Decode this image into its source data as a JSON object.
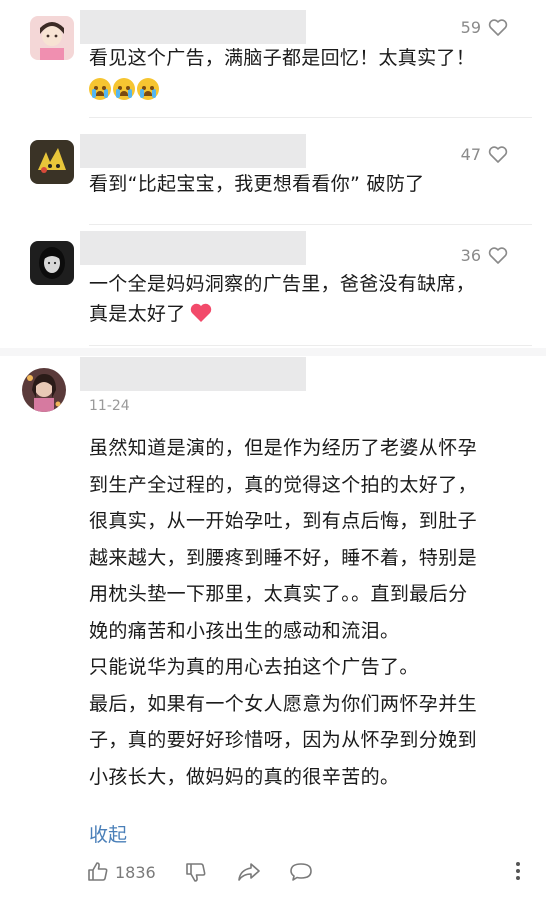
{
  "comments": [
    {
      "like_count": "59",
      "lines": [
        "看见这个广告，满脑子都是回忆！太真实了！"
      ]
    },
    {
      "like_count": "47",
      "lines": [
        "看到“比起宝宝，我更想看看你” 破防了"
      ]
    },
    {
      "like_count": "36",
      "lines": [
        "一个全是妈妈洞察的广告里，爸爸没有缺席，",
        "真是太好了"
      ]
    }
  ],
  "main_comment": {
    "date": "11-24",
    "lines": [
      "虽然知道是演的，但是作为经历了老婆从怀孕",
      "到生产全过程的，真的觉得这个拍的太好了，",
      "很真实，从一开始孕吐，到有点后悔，到肚子",
      "越来越大，到腰疼到睡不好，睡不着，特别是",
      "用枕头垫一下那里，太真实了。。直到最后分",
      "娩的痛苦和小孩出生的感动和流泪。",
      "只能说华为真的用心去拍这个广告了。",
      "最后，如果有一个女人愿意为你们两怀孕并生",
      "子，真的要好好珍惜呀，因为从怀孕到分娩到",
      "小孩长大，做妈妈的真的很辛苦的。"
    ],
    "collapse_label": "收起",
    "like_count": "1836"
  },
  "icons": {
    "heart": "heart-icon",
    "thumbs_up": "thumbs-up-icon",
    "thumbs_down": "thumbs-down-icon",
    "share": "share-icon",
    "reply": "comment-icon",
    "more": "more-icon"
  },
  "colors": {
    "link": "#4a7fb8",
    "heart_emoji": "#f24a6a",
    "muted": "#8a8a8a"
  }
}
